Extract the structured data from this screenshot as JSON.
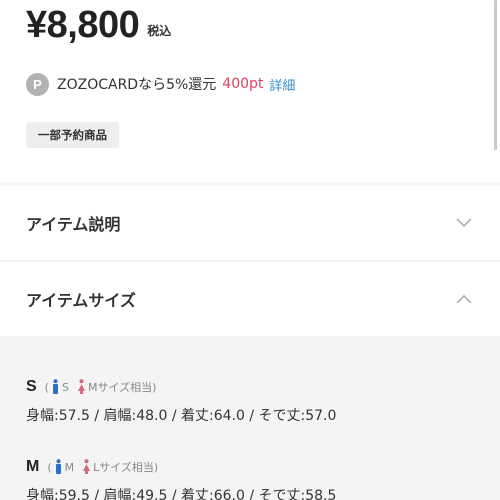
{
  "price": {
    "amount": "¥8,800",
    "tax_label": "税込"
  },
  "points": {
    "badge": "P",
    "text": "ZOZOCARDなら5%還元",
    "value": "400pt",
    "details_label": "詳細"
  },
  "tag": {
    "label": "一部予約商品"
  },
  "sections": {
    "description": {
      "title": "アイテム説明",
      "state": "collapsed",
      "icon": "chevron-down-icon"
    },
    "size": {
      "title": "アイテムサイズ",
      "state": "expanded",
      "icon": "chevron-up-icon"
    }
  },
  "sizes": [
    {
      "name": "S",
      "open_paren": "(",
      "male": "S",
      "female": "Mサイズ相当)",
      "measurements": "身幅:57.5 / 肩幅:48.0 / 着丈:64.0 / そで丈:57.0"
    },
    {
      "name": "M",
      "open_paren": "(",
      "male": "M",
      "female": "Lサイズ相当)",
      "measurements": "身幅:59.5 / 肩幅:49.5 / 着丈:66.0 / そで丈:58.5"
    }
  ],
  "colors": {
    "point": "#d8455e",
    "link": "#3a8bc4",
    "male": "#2a72c4",
    "female": "#d66a7c"
  }
}
